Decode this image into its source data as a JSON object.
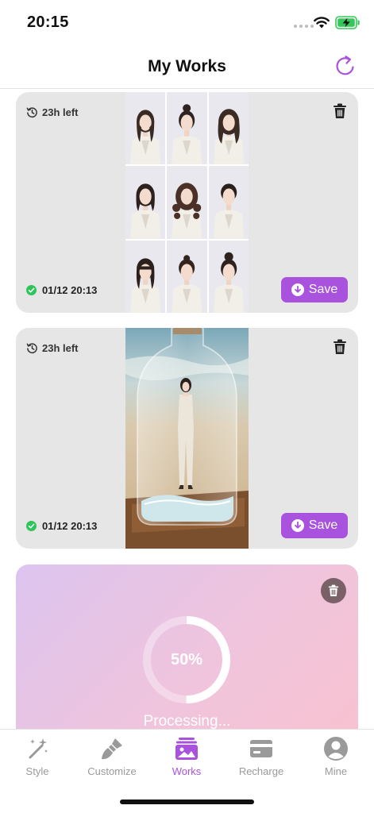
{
  "status_bar": {
    "time": "20:15",
    "icons": [
      "signal-dots-icon",
      "wifi-icon",
      "battery-charging-icon"
    ],
    "battery_color": "#34c759"
  },
  "header": {
    "title": "My Works",
    "refresh_icon": "refresh-icon"
  },
  "works": [
    {
      "time_left": "23h left",
      "completed_at": "01/12 20:13",
      "save_label": "Save",
      "preview": "3x3 grid of portrait photos of a woman in a white blazer",
      "delete_icon": "trash-icon"
    },
    {
      "time_left": "23h left",
      "completed_at": "01/12 20:13",
      "save_label": "Save",
      "preview": "woman in white suit standing inside a glass bottle on a beach",
      "delete_icon": "trash-icon"
    }
  ],
  "processing": {
    "progress_label": "50%",
    "progress": 0.5,
    "status": "Processing..."
  },
  "tab_bar": {
    "items": [
      {
        "label": "Style",
        "icon": "magic-wand-icon",
        "active": false
      },
      {
        "label": "Customize",
        "icon": "brush-icon",
        "active": false
      },
      {
        "label": "Works",
        "icon": "gallery-icon",
        "active": true
      },
      {
        "label": "Recharge",
        "icon": "credit-card-icon",
        "active": false
      },
      {
        "label": "Mine",
        "icon": "user-icon",
        "active": false
      }
    ]
  },
  "colors": {
    "accent": "#a952de",
    "card_background": "#e6e6e6",
    "success": "#2ec55a"
  }
}
